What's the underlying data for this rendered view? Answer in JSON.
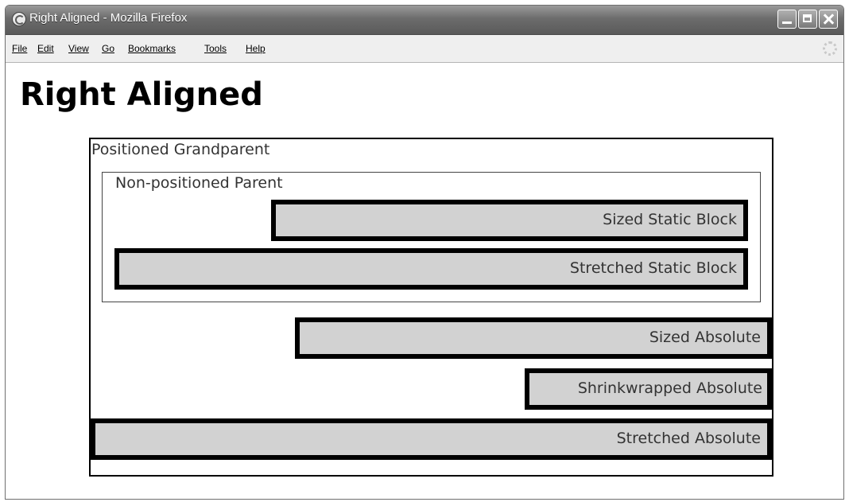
{
  "window": {
    "title": "Right Aligned - Mozilla Firefox"
  },
  "menubar": {
    "items": [
      "File",
      "Edit",
      "View",
      "Go",
      "Bookmarks",
      "Tools",
      "Help"
    ]
  },
  "page": {
    "heading": "Right Aligned",
    "grandparent_label": "Positioned Grandparent",
    "parent_label": "Non-positioned Parent",
    "blocks": {
      "sized_static": "Sized Static Block",
      "stretched_static": "Stretched Static Block",
      "sized_absolute": "Sized Absolute",
      "shrinkwrapped_absolute": "Shrinkwrapped Absolute",
      "stretched_absolute": "Stretched Absolute"
    }
  },
  "colors": {
    "block_fill": "#d2d2d2",
    "block_border": "#000000",
    "titlebar": "#6c6c6c"
  },
  "icons": [
    "firefox-icon",
    "minimize-icon",
    "maximize-icon",
    "close-icon",
    "throbber-icon"
  ]
}
